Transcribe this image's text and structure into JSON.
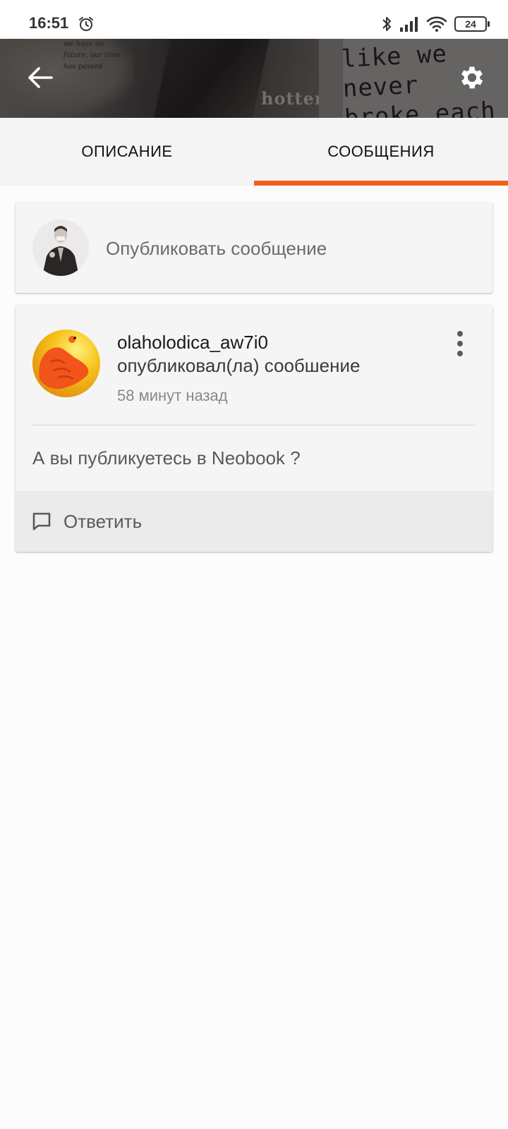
{
  "status_bar": {
    "time": "16:51",
    "battery": "24",
    "icons": [
      "alarm-icon",
      "bluetooth-icon",
      "signal-icon",
      "wifi-icon",
      "battery-icon"
    ]
  },
  "header": {
    "banner_text_left": "we have no future, our time has passed",
    "banner_text_mid": "hotter",
    "banner_text_right": "like we never broke each other's bones",
    "back_icon": "arrow-left-icon",
    "settings_icon": "gear-icon"
  },
  "tabs": [
    {
      "label": "ОПИСАНИЕ",
      "active": false
    },
    {
      "label": "СООБЩЕНИЯ",
      "active": true
    }
  ],
  "compose": {
    "placeholder": "Опубликовать сообщение"
  },
  "post": {
    "username": "olaholodica_aw7i0",
    "action": "опубликовал(ла) сообшение",
    "time": "58 минут назад",
    "body": "А вы публикуетесь в Neobook ?",
    "reply_label": "Ответить",
    "reply_icon": "comment-icon",
    "menu_icon": "more-vertical-icon"
  },
  "colors": {
    "accent": "#f0621c",
    "tab_bar": "#f5f4f5",
    "card": "#f6f5f6",
    "reply_bar": "#ecebec"
  }
}
